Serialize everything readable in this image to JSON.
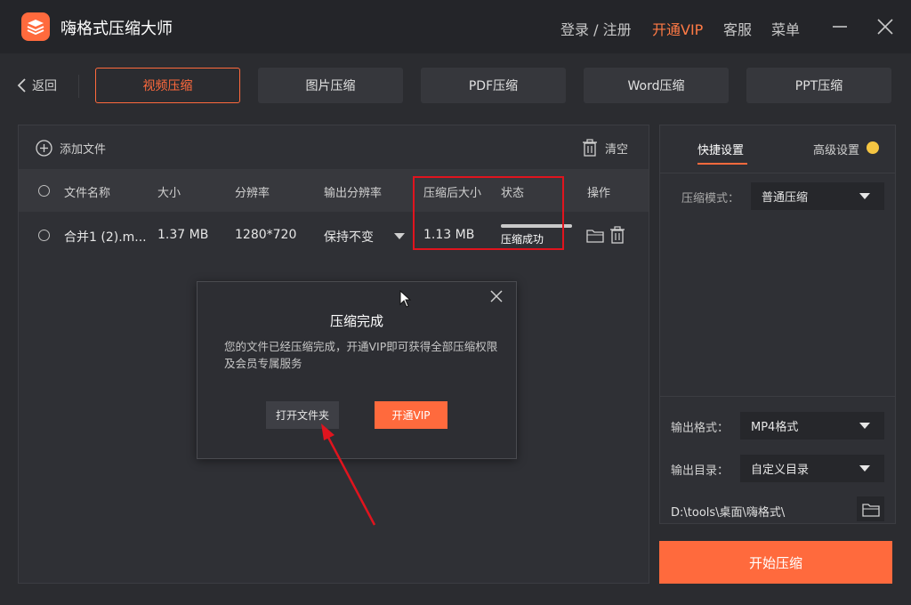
{
  "app": {
    "title": "嗨格式压缩大师",
    "login_label": "登录 / 注册",
    "vip_label": "开通VIP",
    "service_label": "客服",
    "menu_label": "菜单"
  },
  "nav": {
    "back_label": "返回",
    "tabs": [
      {
        "label": "视频压缩",
        "active": true
      },
      {
        "label": "图片压缩",
        "active": false
      },
      {
        "label": "PDF压缩",
        "active": false
      },
      {
        "label": "Word压缩",
        "active": false
      },
      {
        "label": "PPT压缩",
        "active": false
      }
    ]
  },
  "filelist": {
    "add_file_label": "添加文件",
    "clear_label": "清空",
    "columns": [
      "文件名称",
      "大小",
      "分辨率",
      "输出分辨率",
      "压缩后大小",
      "状态",
      "操作"
    ],
    "rows": [
      {
        "name": "合并1 (2).m...",
        "size": "1.37 MB",
        "resolution": "1280*720",
        "output_resolution": "保持不变",
        "compressed_size": "1.13 MB",
        "status": "压缩成功",
        "progress": 1.0
      }
    ]
  },
  "dialog": {
    "title": "压缩完成",
    "message": "您的文件已经压缩完成，开通VIP即可获得全部压缩权限及会员专属服务",
    "open_folder_label": "打开文件夹",
    "vip_label": "开通VIP"
  },
  "settings": {
    "quick_tab": "快捷设置",
    "advanced_tab": "高级设置",
    "mode_label": "压缩模式：",
    "mode_value": "普通压缩",
    "format_label": "输出格式：",
    "format_value": "MP4格式",
    "dir_label": "输出目录：",
    "dir_value": "自定义目录",
    "path": "D:\\tools\\桌面\\嗨格式\\",
    "start_label": "开始压缩"
  },
  "colors": {
    "accent": "#ff6a3d",
    "highlight": "#e0141e",
    "background": "#2b2c30"
  }
}
